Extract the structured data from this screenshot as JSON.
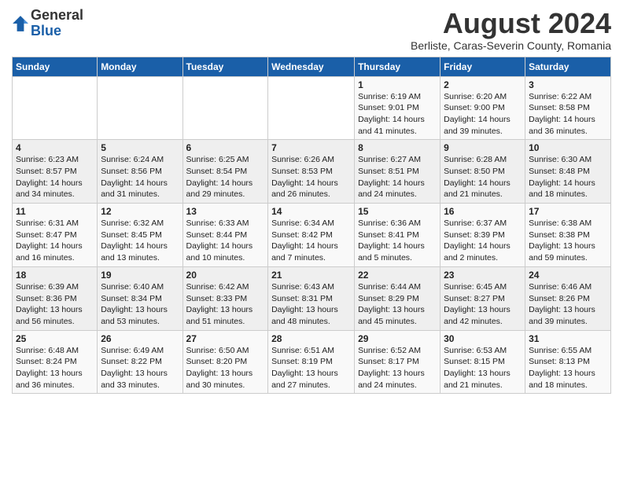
{
  "header": {
    "logo_general": "General",
    "logo_blue": "Blue",
    "main_title": "August 2024",
    "subtitle": "Berliste, Caras-Severin County, Romania"
  },
  "days_of_week": [
    "Sunday",
    "Monday",
    "Tuesday",
    "Wednesday",
    "Thursday",
    "Friday",
    "Saturday"
  ],
  "weeks": [
    [
      {
        "day": "",
        "info": ""
      },
      {
        "day": "",
        "info": ""
      },
      {
        "day": "",
        "info": ""
      },
      {
        "day": "",
        "info": ""
      },
      {
        "day": "1",
        "info": "Sunrise: 6:19 AM\nSunset: 9:01 PM\nDaylight: 14 hours\nand 41 minutes."
      },
      {
        "day": "2",
        "info": "Sunrise: 6:20 AM\nSunset: 9:00 PM\nDaylight: 14 hours\nand 39 minutes."
      },
      {
        "day": "3",
        "info": "Sunrise: 6:22 AM\nSunset: 8:58 PM\nDaylight: 14 hours\nand 36 minutes."
      }
    ],
    [
      {
        "day": "4",
        "info": "Sunrise: 6:23 AM\nSunset: 8:57 PM\nDaylight: 14 hours\nand 34 minutes."
      },
      {
        "day": "5",
        "info": "Sunrise: 6:24 AM\nSunset: 8:56 PM\nDaylight: 14 hours\nand 31 minutes."
      },
      {
        "day": "6",
        "info": "Sunrise: 6:25 AM\nSunset: 8:54 PM\nDaylight: 14 hours\nand 29 minutes."
      },
      {
        "day": "7",
        "info": "Sunrise: 6:26 AM\nSunset: 8:53 PM\nDaylight: 14 hours\nand 26 minutes."
      },
      {
        "day": "8",
        "info": "Sunrise: 6:27 AM\nSunset: 8:51 PM\nDaylight: 14 hours\nand 24 minutes."
      },
      {
        "day": "9",
        "info": "Sunrise: 6:28 AM\nSunset: 8:50 PM\nDaylight: 14 hours\nand 21 minutes."
      },
      {
        "day": "10",
        "info": "Sunrise: 6:30 AM\nSunset: 8:48 PM\nDaylight: 14 hours\nand 18 minutes."
      }
    ],
    [
      {
        "day": "11",
        "info": "Sunrise: 6:31 AM\nSunset: 8:47 PM\nDaylight: 14 hours\nand 16 minutes."
      },
      {
        "day": "12",
        "info": "Sunrise: 6:32 AM\nSunset: 8:45 PM\nDaylight: 14 hours\nand 13 minutes."
      },
      {
        "day": "13",
        "info": "Sunrise: 6:33 AM\nSunset: 8:44 PM\nDaylight: 14 hours\nand 10 minutes."
      },
      {
        "day": "14",
        "info": "Sunrise: 6:34 AM\nSunset: 8:42 PM\nDaylight: 14 hours\nand 7 minutes."
      },
      {
        "day": "15",
        "info": "Sunrise: 6:36 AM\nSunset: 8:41 PM\nDaylight: 14 hours\nand 5 minutes."
      },
      {
        "day": "16",
        "info": "Sunrise: 6:37 AM\nSunset: 8:39 PM\nDaylight: 14 hours\nand 2 minutes."
      },
      {
        "day": "17",
        "info": "Sunrise: 6:38 AM\nSunset: 8:38 PM\nDaylight: 13 hours\nand 59 minutes."
      }
    ],
    [
      {
        "day": "18",
        "info": "Sunrise: 6:39 AM\nSunset: 8:36 PM\nDaylight: 13 hours\nand 56 minutes."
      },
      {
        "day": "19",
        "info": "Sunrise: 6:40 AM\nSunset: 8:34 PM\nDaylight: 13 hours\nand 53 minutes."
      },
      {
        "day": "20",
        "info": "Sunrise: 6:42 AM\nSunset: 8:33 PM\nDaylight: 13 hours\nand 51 minutes."
      },
      {
        "day": "21",
        "info": "Sunrise: 6:43 AM\nSunset: 8:31 PM\nDaylight: 13 hours\nand 48 minutes."
      },
      {
        "day": "22",
        "info": "Sunrise: 6:44 AM\nSunset: 8:29 PM\nDaylight: 13 hours\nand 45 minutes."
      },
      {
        "day": "23",
        "info": "Sunrise: 6:45 AM\nSunset: 8:27 PM\nDaylight: 13 hours\nand 42 minutes."
      },
      {
        "day": "24",
        "info": "Sunrise: 6:46 AM\nSunset: 8:26 PM\nDaylight: 13 hours\nand 39 minutes."
      }
    ],
    [
      {
        "day": "25",
        "info": "Sunrise: 6:48 AM\nSunset: 8:24 PM\nDaylight: 13 hours\nand 36 minutes."
      },
      {
        "day": "26",
        "info": "Sunrise: 6:49 AM\nSunset: 8:22 PM\nDaylight: 13 hours\nand 33 minutes."
      },
      {
        "day": "27",
        "info": "Sunrise: 6:50 AM\nSunset: 8:20 PM\nDaylight: 13 hours\nand 30 minutes."
      },
      {
        "day": "28",
        "info": "Sunrise: 6:51 AM\nSunset: 8:19 PM\nDaylight: 13 hours\nand 27 minutes."
      },
      {
        "day": "29",
        "info": "Sunrise: 6:52 AM\nSunset: 8:17 PM\nDaylight: 13 hours\nand 24 minutes."
      },
      {
        "day": "30",
        "info": "Sunrise: 6:53 AM\nSunset: 8:15 PM\nDaylight: 13 hours\nand 21 minutes."
      },
      {
        "day": "31",
        "info": "Sunrise: 6:55 AM\nSunset: 8:13 PM\nDaylight: 13 hours\nand 18 minutes."
      }
    ]
  ]
}
